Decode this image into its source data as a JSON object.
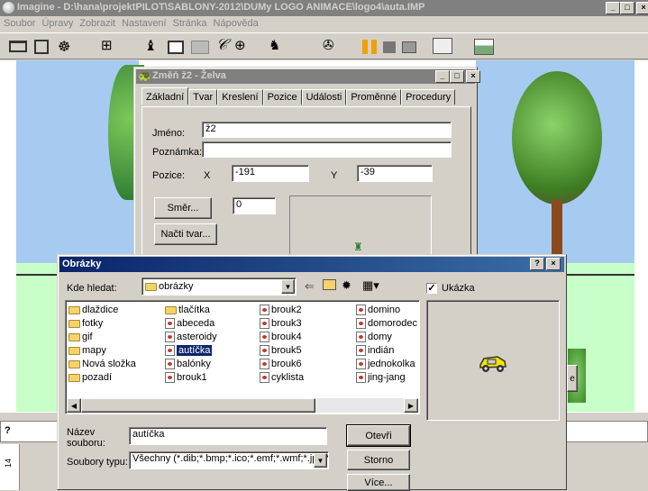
{
  "app": {
    "title": "Imagine - D:\\hana\\projektPILOT\\SABLONY-2012\\DUMy LOGO ANIMACE\\logo4\\auta.IMP",
    "menu": [
      "Soubor",
      "Úpravy",
      "Zobrazit",
      "Nastavení",
      "Stránka",
      "Nápověda"
    ],
    "window_buttons": [
      "_",
      "□",
      "×"
    ],
    "status_q": "?",
    "ruler_mark": "14"
  },
  "toolbar_icons": [
    "open-folder-icon",
    "save-icon",
    "bug-icon",
    "grid-icon",
    "turtle-icon",
    "rectangle-icon",
    "filled-rectangle-icon",
    "pen-icon",
    "globe-icon",
    "sprite-icon",
    "wrench-icon",
    "pause-icon",
    "stop-icon",
    "record-icon",
    "page-icon",
    "image-icon"
  ],
  "turtle_dialog": {
    "title": "Změň ž2 - Želva",
    "tabs": [
      "Základní",
      "Tvar",
      "Kreslení",
      "Pozice",
      "Události",
      "Proměnné",
      "Procedury"
    ],
    "name_label": "Jméno:",
    "name_value": "ž2",
    "note_label": "Poznámka:",
    "note_value": "",
    "position_label": "Pozice:",
    "x_label": "X",
    "x_value": "-191",
    "y_label": "Y",
    "y_value": "-39",
    "direction_button": "Směr...",
    "direction_value": "0",
    "load_shape_button": "Načti tvar..."
  },
  "file_dialog": {
    "title": "Obrázky",
    "help": "?",
    "close": "×",
    "look_in_label": "Kde hledat:",
    "look_in_value": "obrázky",
    "preview_label": "Ukázka",
    "preview_checked": true,
    "columns": [
      [
        {
          "name": "dlaždice",
          "type": "folder"
        },
        {
          "name": "fotky",
          "type": "folder"
        },
        {
          "name": "gif",
          "type": "folder"
        },
        {
          "name": "mapy",
          "type": "folder"
        },
        {
          "name": "Nová složka",
          "type": "folder"
        },
        {
          "name": "pozadí",
          "type": "folder"
        }
      ],
      [
        {
          "name": "tlačítka",
          "type": "folder"
        },
        {
          "name": "abeceda",
          "type": "file"
        },
        {
          "name": "asteroidy",
          "type": "file"
        },
        {
          "name": "autíčka",
          "type": "file",
          "selected": true
        },
        {
          "name": "balónky",
          "type": "file"
        },
        {
          "name": "brouk1",
          "type": "file"
        }
      ],
      [
        {
          "name": "brouk2",
          "type": "file"
        },
        {
          "name": "brouk3",
          "type": "file"
        },
        {
          "name": "brouk4",
          "type": "file"
        },
        {
          "name": "brouk5",
          "type": "file"
        },
        {
          "name": "brouk6",
          "type": "file"
        },
        {
          "name": "cyklista",
          "type": "file"
        }
      ],
      [
        {
          "name": "domino",
          "type": "file"
        },
        {
          "name": "domorodec",
          "type": "file"
        },
        {
          "name": "domy",
          "type": "file"
        },
        {
          "name": "indián",
          "type": "file"
        },
        {
          "name": "jednokolka",
          "type": "file"
        },
        {
          "name": "jing-jang",
          "type": "file"
        }
      ]
    ],
    "filename_label": "Název souboru:",
    "filename_value": "autíčka",
    "filetype_label": "Soubory typu:",
    "filetype_value": "Všechny (*.dib;*.bmp;*.ico;*.emf;*.wmf;*.jpg;*",
    "open_button": "Otevři",
    "cancel_button": "Storno",
    "more_button": "Více..."
  },
  "colors": {
    "sky": "#a6caf0",
    "grass": "#c8ffc8",
    "title_active": "#0a246a",
    "title_inactive": "#808080",
    "selection": "#0a246a",
    "car": "#f5e400"
  }
}
